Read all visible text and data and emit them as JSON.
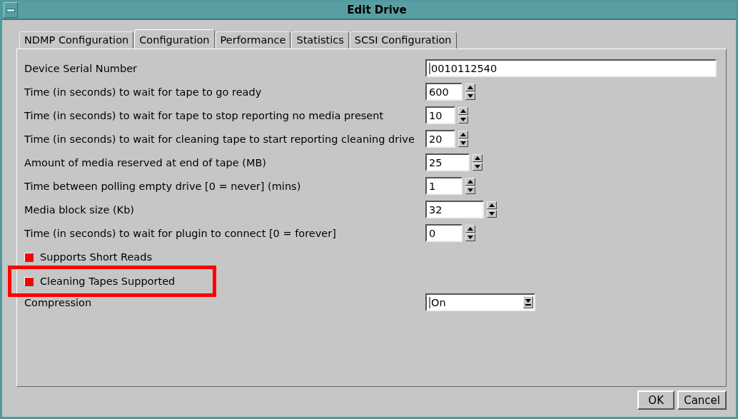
{
  "window": {
    "title": "Edit Drive"
  },
  "tabs": [
    {
      "label": "NDMP Configuration",
      "selected": false
    },
    {
      "label": "Configuration",
      "selected": true
    },
    {
      "label": "Performance",
      "selected": false
    },
    {
      "label": "Statistics",
      "selected": false
    },
    {
      "label": "SCSI Configuration",
      "selected": false
    }
  ],
  "fields": [
    {
      "kind": "text",
      "label": "Device Serial Number",
      "value": "0010112540"
    },
    {
      "kind": "spinner",
      "label": "Time (in seconds) to wait for tape to go ready",
      "value": "600"
    },
    {
      "kind": "spinner",
      "label": "Time (in seconds) to wait for tape to stop reporting no media present",
      "value": "10"
    },
    {
      "kind": "spinner",
      "label": "Time (in seconds) to wait for cleaning tape to start reporting cleaning drive",
      "value": "20"
    },
    {
      "kind": "spinner",
      "label": "Amount of media reserved at end of tape (MB)",
      "value": "25"
    },
    {
      "kind": "spinner",
      "label": "Time between polling empty drive [0 = never] (mins)",
      "value": "1"
    },
    {
      "kind": "spinner",
      "label": "Media block size (Kb)",
      "value": "32"
    },
    {
      "kind": "spinner",
      "label": "Time (in seconds) to wait for plugin to connect [0 = forever]",
      "value": "0"
    }
  ],
  "checkboxes": [
    {
      "label": "Supports Short Reads",
      "checked": true,
      "highlighted": false
    },
    {
      "label": "Cleaning Tapes Supported",
      "checked": true,
      "highlighted": true
    }
  ],
  "compression": {
    "label": "Compression",
    "value": "On"
  },
  "buttons": [
    "OK",
    "Cancel"
  ]
}
